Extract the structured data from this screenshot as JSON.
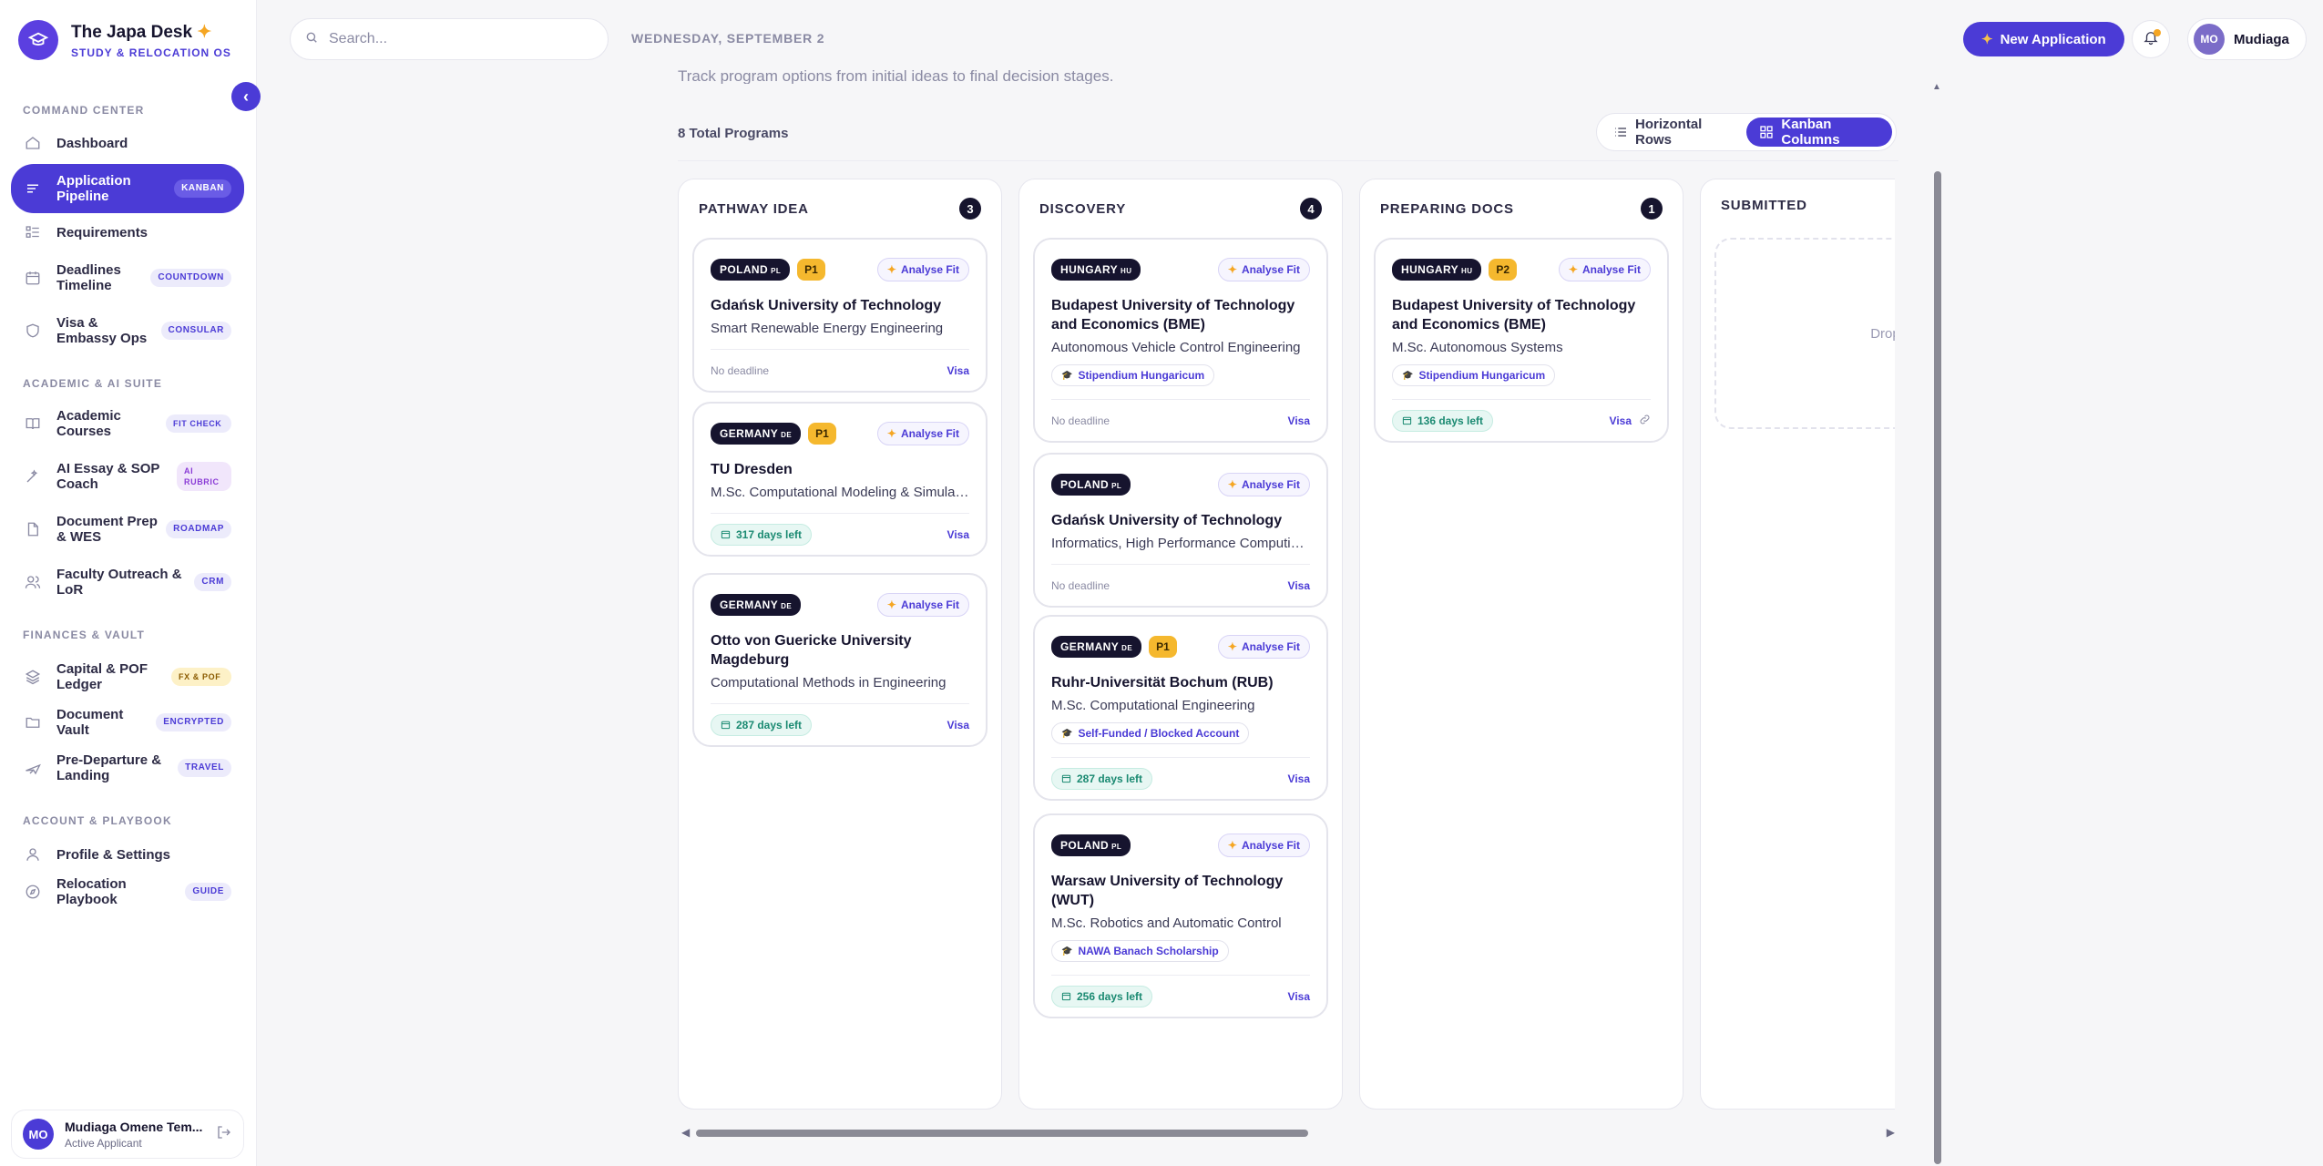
{
  "brand": {
    "title": "The Japa Desk",
    "subtitle": "STUDY & RELOCATION OS"
  },
  "sidebar": {
    "sections": [
      {
        "label": "COMMAND CENTER"
      },
      {
        "label": "ACADEMIC & AI SUITE"
      },
      {
        "label": "FINANCES & VAULT"
      },
      {
        "label": "ACCOUNT & PLAYBOOK"
      }
    ],
    "items": [
      {
        "label": "Dashboard",
        "tag": ""
      },
      {
        "label": "Application Pipeline",
        "tag": "KANBAN"
      },
      {
        "label": "Requirements",
        "tag": ""
      },
      {
        "label": "Deadlines Timeline",
        "tag": "COUNTDOWN"
      },
      {
        "label": "Visa & Embassy Ops",
        "tag": "CONSULAR"
      },
      {
        "label": "Academic Courses",
        "tag": "FIT CHECK"
      },
      {
        "label": "AI Essay & SOP Coach",
        "tag": "AI RUBRIC"
      },
      {
        "label": "Document Prep & WES",
        "tag": "ROADMAP"
      },
      {
        "label": "Faculty Outreach & LoR",
        "tag": "CRM"
      },
      {
        "label": "Capital & POF Ledger",
        "tag": "FX & POF"
      },
      {
        "label": "Document Vault",
        "tag": "ENCRYPTED"
      },
      {
        "label": "Pre-Departure & Landing",
        "tag": "TRAVEL"
      },
      {
        "label": "Profile & Settings",
        "tag": ""
      },
      {
        "label": "Relocation Playbook",
        "tag": "GUIDE"
      }
    ],
    "user": {
      "initials": "MO",
      "name": "Mudiaga Omene Tem...",
      "role": "Active Applicant"
    }
  },
  "topbar": {
    "search_placeholder": "Search...",
    "date": "WEDNESDAY, SEPTEMBER 2",
    "new_application": "New Application",
    "profile_initials": "MO",
    "profile_name": "Mudiaga"
  },
  "main": {
    "subtitle": "Track program options from initial ideas to final decision stages.",
    "total": "8 Total Programs",
    "views": {
      "rows": "Horizontal Rows",
      "kanban": "Kanban Columns"
    }
  },
  "columns": [
    {
      "title": "PATHWAY IDEA",
      "count": "3",
      "cards": [
        {
          "country": "POLAND",
          "code": "PL",
          "priority": "P1",
          "analyse": "Analyse Fit",
          "university": "Gdańsk University of Technology",
          "program": "Smart Renewable Energy Engineering",
          "scholarship": "",
          "deadline": "No deadline",
          "days": "",
          "visa": "Visa"
        },
        {
          "country": "GERMANY",
          "code": "DE",
          "priority": "P1",
          "analyse": "Analyse Fit",
          "university": "TU Dresden",
          "program": "M.Sc. Computational Modeling & Simulation",
          "scholarship": "",
          "deadline": "",
          "days": "317 days left",
          "visa": "Visa"
        },
        {
          "country": "GERMANY",
          "code": "DE",
          "priority": "",
          "analyse": "Analyse Fit",
          "university": "Otto von Guericke University Magdeburg",
          "program": "Computational Methods in Engineering",
          "scholarship": "",
          "deadline": "",
          "days": "287 days left",
          "visa": "Visa"
        }
      ]
    },
    {
      "title": "DISCOVERY",
      "count": "4",
      "cards": [
        {
          "country": "HUNGARY",
          "code": "HU",
          "priority": "",
          "analyse": "Analyse Fit",
          "university": "Budapest University of Technology and Economics (BME)",
          "program": "Autonomous Vehicle Control Engineering",
          "scholarship": "Stipendium Hungaricum",
          "deadline": "No deadline",
          "days": "",
          "visa": "Visa"
        },
        {
          "country": "POLAND",
          "code": "PL",
          "priority": "",
          "analyse": "Analyse Fit",
          "university": "Gdańsk University of Technology",
          "program": "Informatics, High Performance Computing ...",
          "scholarship": "",
          "deadline": "No deadline",
          "days": "",
          "visa": "Visa"
        },
        {
          "country": "GERMANY",
          "code": "DE",
          "priority": "P1",
          "analyse": "Analyse Fit",
          "university": "Ruhr-Universität Bochum (RUB)",
          "program": "M.Sc. Computational Engineering",
          "scholarship": "Self-Funded / Blocked Account",
          "deadline": "",
          "days": "287 days left",
          "visa": "Visa"
        },
        {
          "country": "POLAND",
          "code": "PL",
          "priority": "",
          "analyse": "Analyse Fit",
          "university": "Warsaw University of Technology (WUT)",
          "program": "M.Sc. Robotics and Automatic Control",
          "scholarship": "NAWA Banach Scholarship",
          "deadline": "",
          "days": "256 days left",
          "visa": "Visa"
        }
      ]
    },
    {
      "title": "PREPARING DOCS",
      "count": "1",
      "cards": [
        {
          "country": "HUNGARY",
          "code": "HU",
          "priority": "P2",
          "analyse": "Analyse Fit",
          "university": "Budapest University of Technology and Economics (BME)",
          "program": "M.Sc. Autonomous Systems",
          "scholarship": "Stipendium Hungaricum",
          "deadline": "",
          "days": "136 days left",
          "visa": "Visa"
        }
      ]
    },
    {
      "title": "SUBMITTED",
      "count": "",
      "dropzone": "Drop cards here"
    }
  ]
}
